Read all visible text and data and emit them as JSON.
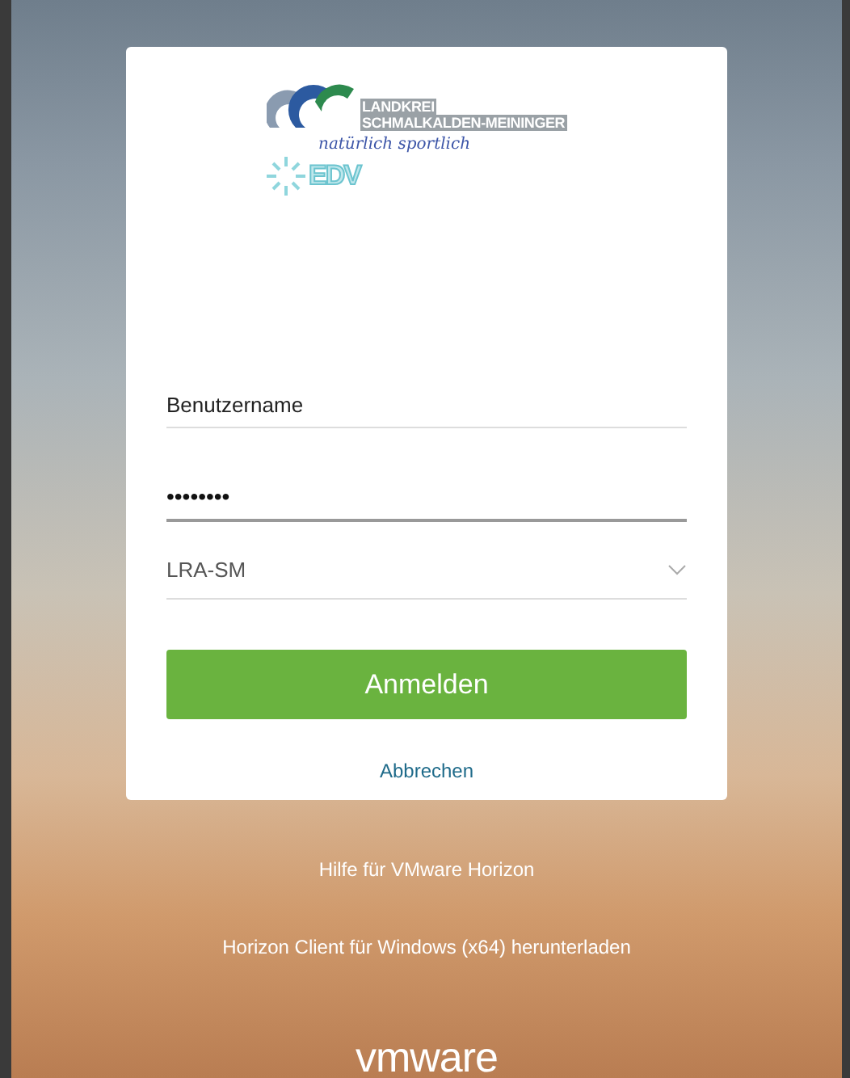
{
  "logo": {
    "line_1": "LANDKREI",
    "line_2": "SCHMALKALDEN-MEININGER",
    "slogan": "natürlich sportlich",
    "badge": "EDV"
  },
  "form": {
    "username": {
      "placeholder": "Benutzername"
    },
    "password": {
      "value": "••••••••",
      "focused": true
    },
    "domain": {
      "value": "LRA-SM"
    },
    "submit": "Anmelden",
    "cancel": "Abbrechen"
  },
  "links": [
    "Hilfe für VMware Horizon",
    "Horizon Client für Windows (x64) herunterladen"
  ],
  "footer_logo": "vmware"
}
